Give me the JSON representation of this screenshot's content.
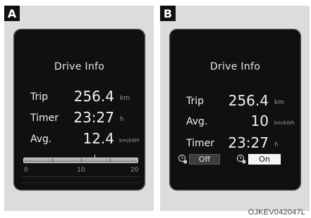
{
  "panels": [
    {
      "badge": "A",
      "title": "Drive Info",
      "rows": [
        {
          "label": "Trip",
          "value": "256.4",
          "unit": "km"
        },
        {
          "label": "Timer",
          "value": "23:27",
          "unit": "h"
        },
        {
          "label": "Avg.",
          "value": "12.4",
          "unit": "km/kWh"
        }
      ],
      "gauge": {
        "ticks": [
          "0",
          "10",
          "20"
        ],
        "level": 12.4,
        "max": 20
      }
    },
    {
      "badge": "B",
      "title": "Drive Info",
      "rows": [
        {
          "label": "Trip",
          "value": "256.4",
          "unit": "km"
        },
        {
          "label": "Avg.",
          "value": "10",
          "unit": "km/kWh"
        },
        {
          "label": "Timer",
          "value": "23:27",
          "unit": "h"
        }
      ],
      "toggles": {
        "off_label": "Off",
        "on_label": "On",
        "icons": [
          "clock-reset-icon",
          "clock-auto-icon"
        ]
      }
    }
  ],
  "footer_code": "OJKEV042047L"
}
